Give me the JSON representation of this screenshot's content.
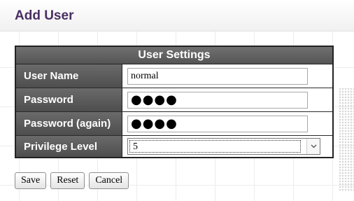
{
  "page": {
    "title": "Add User"
  },
  "user_settings": {
    "header": "User Settings",
    "fields": {
      "user_name": {
        "label": "User Name",
        "value": "normal"
      },
      "password": {
        "label": "Password",
        "value": "●●●●"
      },
      "password_again": {
        "label": "Password (again)",
        "value": "●●●●"
      },
      "privilege_level": {
        "label": "Privilege Level",
        "value": "5"
      }
    }
  },
  "actions": {
    "save": "Save",
    "reset": "Reset",
    "cancel": "Cancel"
  },
  "icons": {
    "select_arrow": "chevron-down-icon"
  }
}
